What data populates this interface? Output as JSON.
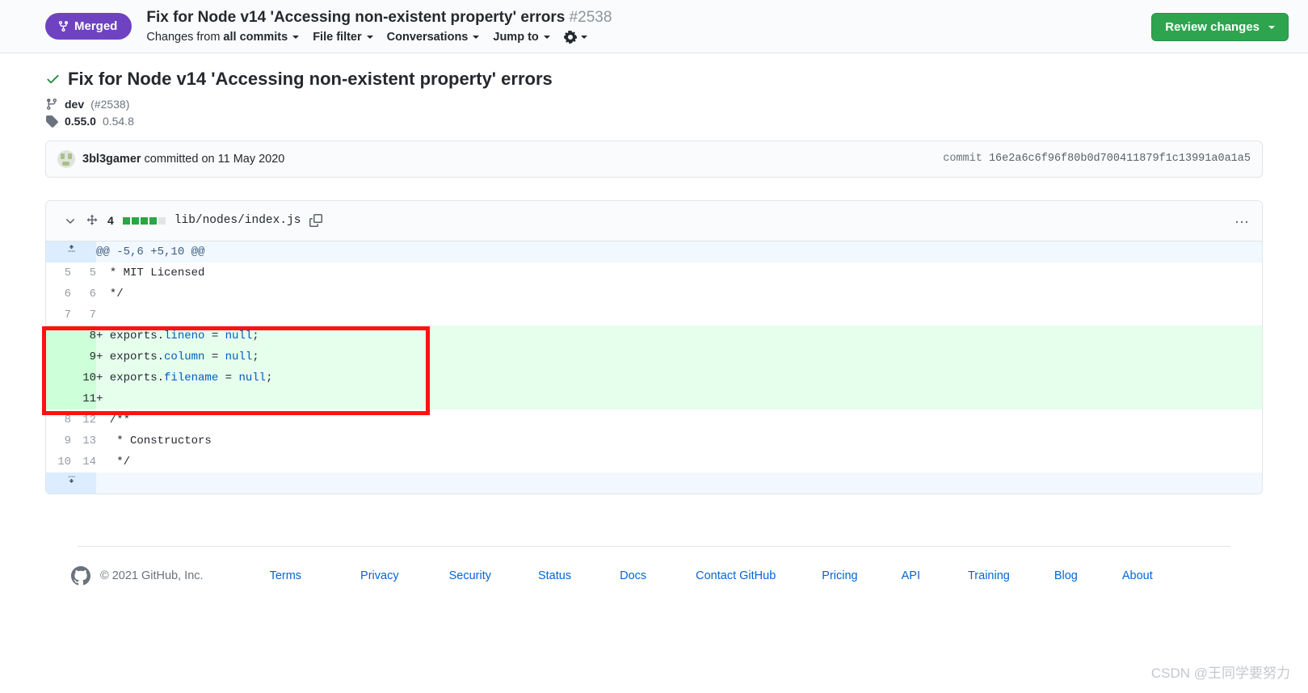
{
  "header": {
    "status_badge": {
      "label": "Merged",
      "icon": "git-merge-icon",
      "color": "#6f42c1"
    },
    "pr_title": "Fix for Node v14 'Accessing non-existent property' errors",
    "pr_number": "#2538",
    "subnav": [
      {
        "prefix": "Changes from",
        "strong": "all commits",
        "name": "changes-from"
      },
      {
        "prefix": "",
        "strong": "File filter",
        "name": "file-filter"
      },
      {
        "prefix": "",
        "strong": "Conversations",
        "name": "conversations"
      },
      {
        "prefix": "",
        "strong": "Jump to",
        "name": "jump-to"
      }
    ],
    "settings_icon": "gear-icon",
    "review_button": {
      "label": "Review changes",
      "color": "#2ea44f"
    }
  },
  "commit": {
    "title": "Fix for Node v14 'Accessing non-existent property' errors",
    "status_icon": "check-icon",
    "branch_icon": "git-branch-icon",
    "branch": "dev",
    "branch_pr": "(#2538)",
    "tag_icon": "tag-icon",
    "tag_primary": "0.55.0",
    "tag_secondary": "0.54.8",
    "author": "3bl3gamer",
    "author_action": "committed on 11 May 2020",
    "commit_label": "commit",
    "commit_sha": "16e2a6c6f96f80b0d700411879f1c13991a0a1a5"
  },
  "diff": {
    "file": {
      "changes_count": "4",
      "blocks": [
        "add",
        "add",
        "add",
        "add",
        "none"
      ],
      "path": "lib/nodes/index.js",
      "collapse_icon": "chevron-down-icon",
      "diffstat_icon": "diff-expand-icon",
      "copy_icon": "copy-path-icon",
      "menu_icon": "kebab-horizontal-icon"
    },
    "hunk_header": "@@ -5,6 +5,10 @@",
    "expand_up_icon": "expand-up-icon",
    "expand_down_icon": "expand-down-icon",
    "rows": [
      {
        "type": "ctx",
        "old": "5",
        "new": "5",
        "code": "  * MIT Licensed"
      },
      {
        "type": "ctx",
        "old": "6",
        "new": "6",
        "code": "  */"
      },
      {
        "type": "ctx",
        "old": "7",
        "new": "7",
        "code": ""
      },
      {
        "type": "add",
        "old": "",
        "new": "8",
        "code": "+ exports.lineno = null;",
        "prefix": "+ exports.",
        "prop": "lineno",
        "mid": " = ",
        "nul": "null",
        "suffix": ";"
      },
      {
        "type": "add",
        "old": "",
        "new": "9",
        "code": "+ exports.column = null;",
        "prefix": "+ exports.",
        "prop": "column",
        "mid": " = ",
        "nul": "null",
        "suffix": ";"
      },
      {
        "type": "add",
        "old": "",
        "new": "10",
        "code": "+ exports.filename = null;",
        "prefix": "+ exports.",
        "prop": "filename",
        "mid": " = ",
        "nul": "null",
        "suffix": ";"
      },
      {
        "type": "add",
        "old": "",
        "new": "11",
        "code": "+"
      },
      {
        "type": "ctx",
        "old": "8",
        "new": "12",
        "code": "  /**"
      },
      {
        "type": "ctx",
        "old": "9",
        "new": "13",
        "code": "   * Constructors"
      },
      {
        "type": "ctx",
        "old": "10",
        "new": "14",
        "code": "   */"
      }
    ]
  },
  "footer": {
    "logo_icon": "github-mark-icon",
    "copyright": "© 2021 GitHub, Inc.",
    "links": [
      "Terms",
      "Privacy",
      "Security",
      "Status",
      "Docs",
      "Contact GitHub",
      "Pricing",
      "API",
      "Training",
      "Blog",
      "About"
    ]
  },
  "watermark": "CSDN @王同学要努力"
}
